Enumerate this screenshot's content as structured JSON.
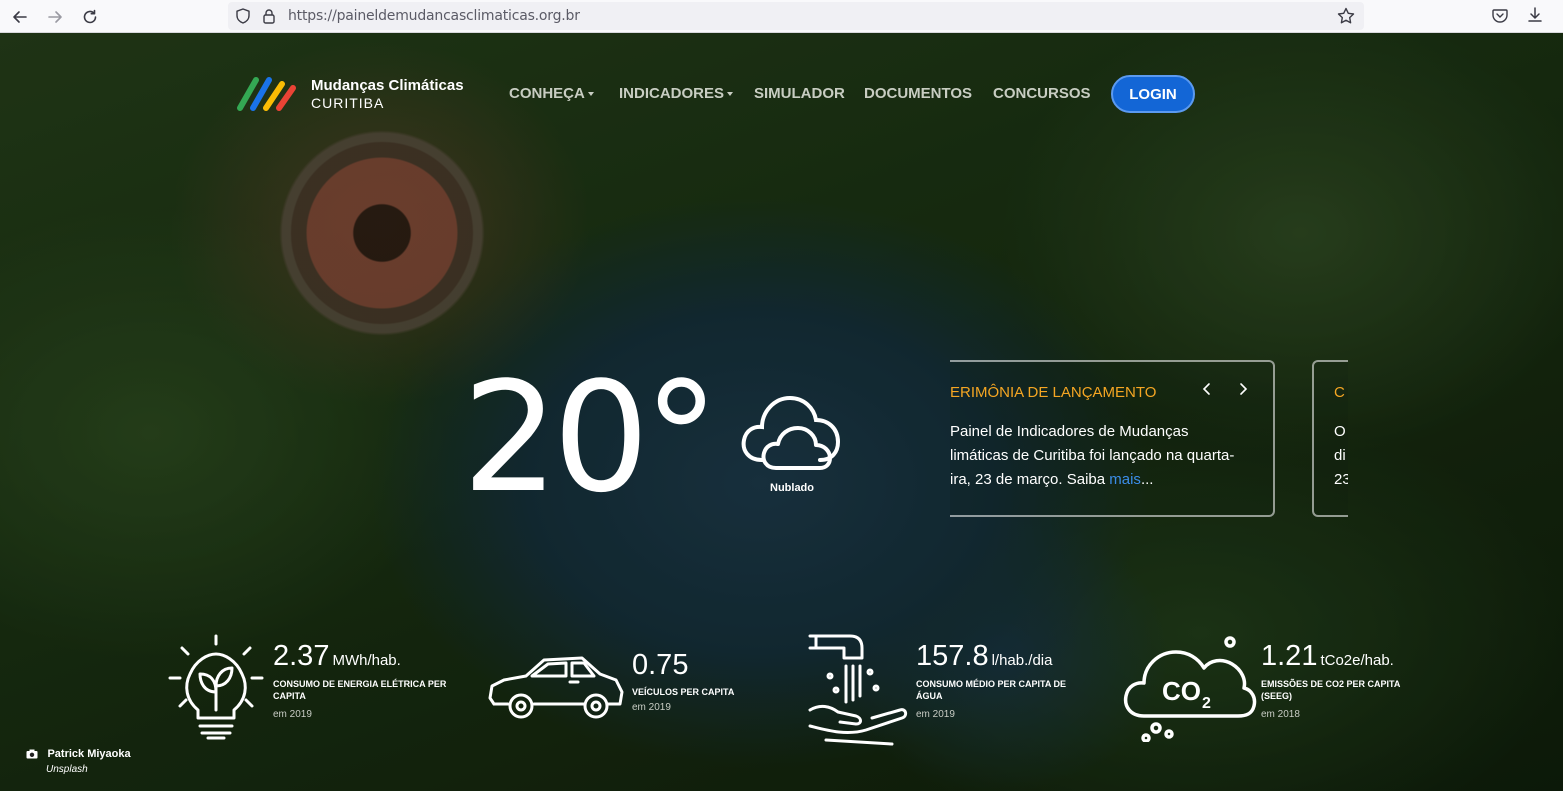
{
  "browser": {
    "url": "https://paineldemudancasclimaticas.org.br",
    "icons": [
      "back-arrow-icon",
      "forward-arrow-icon",
      "reload-icon",
      "shield-icon",
      "lock-icon",
      "star-icon",
      "pocket-icon",
      "download-icon"
    ]
  },
  "header": {
    "logo_title": "Mudanças Climáticas",
    "logo_subtitle": "CURITIBA",
    "logo_colors": [
      "#34a853",
      "#1a73e8",
      "#fbbc04",
      "#ea4335"
    ],
    "nav": [
      {
        "label": "CONHEÇA",
        "dropdown": true
      },
      {
        "label": "INDICADORES",
        "dropdown": true
      },
      {
        "label": "SIMULADOR",
        "dropdown": false
      },
      {
        "label": "DOCUMENTOS",
        "dropdown": false
      },
      {
        "label": "CONCURSOS",
        "dropdown": false
      }
    ],
    "login_label": "LOGIN"
  },
  "weather": {
    "temperature": "20°",
    "condition": "Nublado",
    "icon": "cloud-icon"
  },
  "news": {
    "card1": {
      "title": "ERIMÔNIA DE LANÇAMENTO",
      "text": " Painel de Indicadores de Mudanças limáticas de Curitiba foi lançado na quarta-ira, 23 de março. Saiba ",
      "link": "mais",
      "ellipsis": "..."
    },
    "card2": {
      "title": "C",
      "line1": "O",
      "line2": "di",
      "line3": "23"
    },
    "accent_color": "#f5a623"
  },
  "indicators": [
    {
      "value": "2.37",
      "unit": "MWh/hab.",
      "label": "CONSUMO DE ENERGIA ELÉTRICA PER CAPITA",
      "year": "em 2019",
      "icon": "lightbulb-plant-icon"
    },
    {
      "value": "0.75",
      "unit": "",
      "label": "VEÍCULOS PER CAPITA",
      "year": "em 2019",
      "icon": "car-icon"
    },
    {
      "value": "157.8",
      "unit": "l/hab./dia",
      "label": "CONSUMO MÉDIO PER CAPITA DE ÁGUA",
      "year": "em 2019",
      "icon": "water-tap-hand-icon"
    },
    {
      "value": "1.21",
      "unit": "tCo2e/hab.",
      "label": "EMISSÕES DE CO2 PER CAPITA (SEEG)",
      "year": "em 2018",
      "icon": "co2-cloud-icon",
      "icon_text": "CO",
      "icon_sub": "2"
    }
  ],
  "credit": {
    "name": "Patrick Miyaoka",
    "source": "Unsplash"
  }
}
